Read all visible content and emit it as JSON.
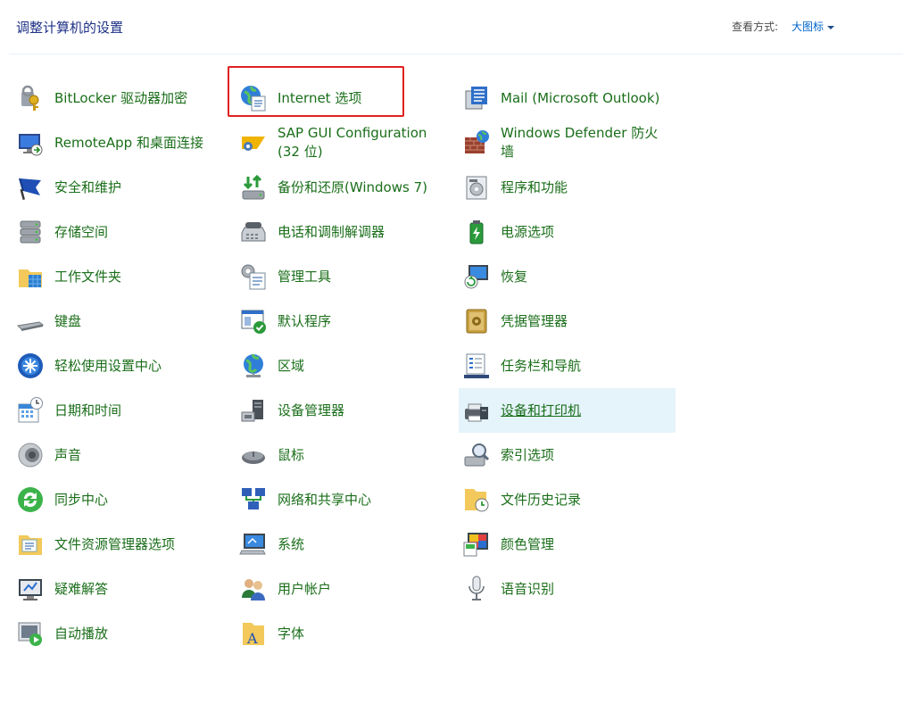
{
  "header": {
    "title": "调整计算机的设置",
    "view_label": "查看方式:",
    "view_value": "大图标"
  },
  "items": [
    {
      "label": "BitLocker 驱动器加密",
      "icon": "bitlocker-key-icon"
    },
    {
      "label": "RemoteApp 和桌面连接",
      "icon": "remoteapp-monitor-icon"
    },
    {
      "label": "安全和维护",
      "icon": "flag-icon"
    },
    {
      "label": "存储空间",
      "icon": "storage-drives-icon"
    },
    {
      "label": "工作文件夹",
      "icon": "work-folder-icon"
    },
    {
      "label": "键盘",
      "icon": "keyboard-icon"
    },
    {
      "label": "轻松使用设置中心",
      "icon": "ease-of-access-icon"
    },
    {
      "label": "日期和时间",
      "icon": "calendar-clock-icon"
    },
    {
      "label": "声音",
      "icon": "speaker-icon"
    },
    {
      "label": "同步中心",
      "icon": "sync-icon"
    },
    {
      "label": "文件资源管理器选项",
      "icon": "folder-options-icon"
    },
    {
      "label": "疑难解答",
      "icon": "troubleshoot-monitor-icon"
    },
    {
      "label": "自动播放",
      "icon": "autoplay-icon"
    },
    {
      "label": "Internet 选项",
      "icon": "globe-document-icon"
    },
    {
      "label": "SAP GUI Configuration (32 位)",
      "icon": "sap-gui-icon"
    },
    {
      "label": "备份和还原(Windows 7)",
      "icon": "backup-restore-icon"
    },
    {
      "label": "电话和调制解调器",
      "icon": "telephone-modem-icon"
    },
    {
      "label": "管理工具",
      "icon": "admin-tools-icon"
    },
    {
      "label": "默认程序",
      "icon": "default-programs-icon"
    },
    {
      "label": "区域",
      "icon": "region-globe-icon"
    },
    {
      "label": "设备管理器",
      "icon": "device-manager-icon"
    },
    {
      "label": "鼠标",
      "icon": "mouse-icon"
    },
    {
      "label": "网络和共享中心",
      "icon": "network-icon"
    },
    {
      "label": "系统",
      "icon": "system-computer-icon"
    },
    {
      "label": "用户帐户",
      "icon": "user-accounts-icon"
    },
    {
      "label": "字体",
      "icon": "fonts-folder-icon"
    },
    {
      "label": "Mail (Microsoft Outlook)",
      "icon": "mail-icon"
    },
    {
      "label": "Windows Defender 防火墙",
      "icon": "firewall-icon"
    },
    {
      "label": "程序和功能",
      "icon": "programs-features-icon"
    },
    {
      "label": "电源选项",
      "icon": "power-options-icon"
    },
    {
      "label": "恢复",
      "icon": "recovery-icon"
    },
    {
      "label": "凭据管理器",
      "icon": "credential-vault-icon"
    },
    {
      "label": "任务栏和导航",
      "icon": "taskbar-icon"
    },
    {
      "label": "设备和打印机",
      "icon": "printer-icon"
    },
    {
      "label": "索引选项",
      "icon": "indexing-icon"
    },
    {
      "label": "文件历史记录",
      "icon": "file-history-icon"
    },
    {
      "label": "颜色管理",
      "icon": "color-management-icon"
    },
    {
      "label": "语音识别",
      "icon": "microphone-icon"
    }
  ],
  "colors": {
    "label_green": "#1a6e1a",
    "title_blue": "#1e3287",
    "link_blue": "#0066cc",
    "hover_bg": "#e5f3fb",
    "highlight_red": "#e02020"
  }
}
